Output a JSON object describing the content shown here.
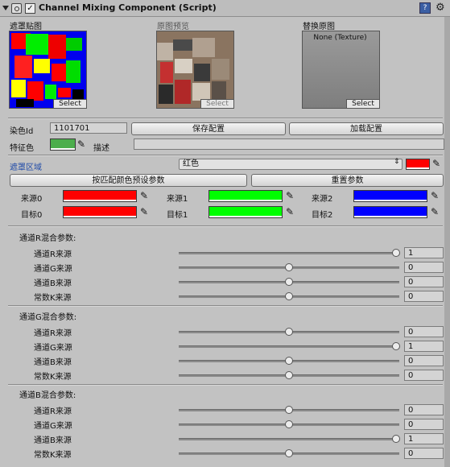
{
  "header": {
    "title": "Channel Mixing Component (Script)",
    "enabled": true
  },
  "textures": {
    "mask": {
      "label": "遮罩贴图",
      "select": "Select"
    },
    "preview": {
      "label": "原图预览",
      "select": "Select"
    },
    "replace": {
      "label": "替换原图",
      "value": "None (Texture)",
      "select": "Select"
    }
  },
  "dye_id": {
    "label": "染色Id",
    "value": "1101701"
  },
  "save_button": "保存配置",
  "load_button": "加载配置",
  "feature_color": {
    "label": "特征色",
    "color": "#4cae4c"
  },
  "description_label": "描述",
  "mask_region": {
    "label": "遮罩区域",
    "selected": "红色",
    "color": "#ff0000"
  },
  "match_button": "按匹配颜色预设参数",
  "reset_button": "重置参数",
  "sources": [
    {
      "label": "来源0",
      "color": "#ff0000"
    },
    {
      "label": "来源1",
      "color": "#00ff00"
    },
    {
      "label": "来源2",
      "color": "#0000ff"
    }
  ],
  "targets": [
    {
      "label": "目标0",
      "color": "#ff0000"
    },
    {
      "label": "目标1",
      "color": "#00ff00"
    },
    {
      "label": "目标2",
      "color": "#0000ff"
    }
  ],
  "mix_sections": [
    {
      "title": "通道R混合参数:",
      "rows": [
        {
          "label": "通道R来源",
          "value": "1",
          "level": 1
        },
        {
          "label": "通道G来源",
          "value": "0",
          "level": 0
        },
        {
          "label": "通道B来源",
          "value": "0",
          "level": 0
        },
        {
          "label": "常数K来源",
          "value": "0",
          "level": 0
        }
      ]
    },
    {
      "title": "通道G混合参数:",
      "rows": [
        {
          "label": "通道R来源",
          "value": "0",
          "level": 0
        },
        {
          "label": "通道G来源",
          "value": "1",
          "level": 1
        },
        {
          "label": "通道B来源",
          "value": "0",
          "level": 0
        },
        {
          "label": "常数K来源",
          "value": "0",
          "level": 0
        }
      ]
    },
    {
      "title": "通道B混合参数:",
      "rows": [
        {
          "label": "通道R来源",
          "value": "0",
          "level": 0
        },
        {
          "label": "通道G来源",
          "value": "0",
          "level": 0
        },
        {
          "label": "通道B来源",
          "value": "1",
          "level": 1
        },
        {
          "label": "常数K来源",
          "value": "0",
          "level": 0
        }
      ]
    }
  ]
}
